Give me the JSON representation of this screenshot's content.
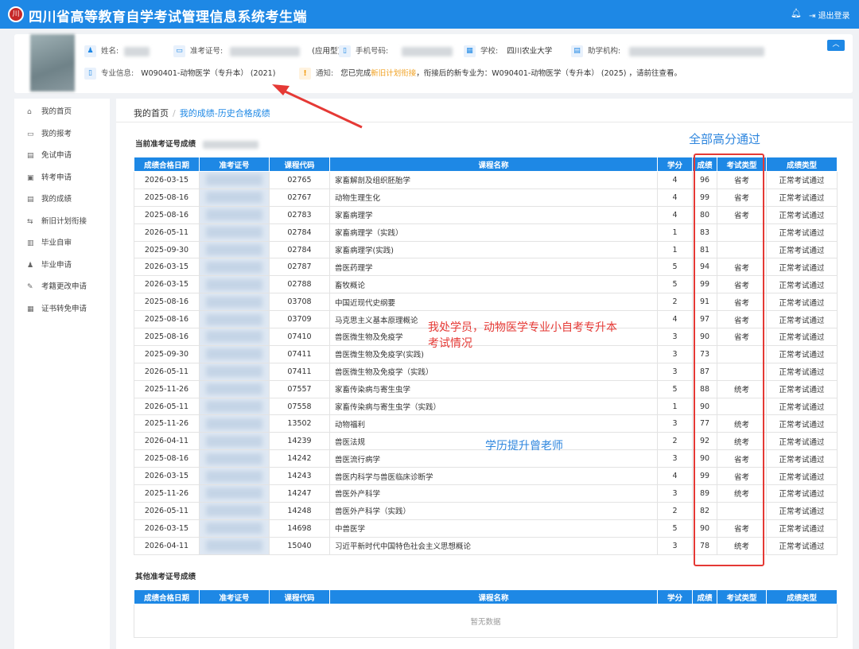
{
  "app": {
    "title": "四川省高等教育自学考试管理信息系统考生端",
    "logo_text": "川",
    "logout": "退出登录"
  },
  "profile": {
    "name_label": "姓名:",
    "ticket_label": "准考证号:",
    "ticket_type": "(应用型)",
    "phone_label": "手机号码:",
    "school_label": "学校:",
    "school_value": "四川农业大学",
    "agency_label": "助学机构:",
    "major_label": "专业信息:",
    "major_value": "W090401-动物医学（专升本） (2021)",
    "notice_label": "通知:",
    "notice_prefix": "您已完成",
    "notice_link": "新旧计划衔接",
    "notice_suffix": "，衔接后的新专业为：W090401-动物医学（专升本） (2025) ，请前往查看。"
  },
  "sidebar": {
    "items": [
      {
        "icon": "home-icon",
        "glyph": "⌂",
        "label": "我的首页"
      },
      {
        "icon": "calendar-icon",
        "glyph": "▭",
        "label": "我的报考"
      },
      {
        "icon": "file-icon",
        "glyph": "▤",
        "label": "免试申请"
      },
      {
        "icon": "lock-icon",
        "glyph": "▣",
        "label": "转考申请"
      },
      {
        "icon": "document-icon",
        "glyph": "▤",
        "label": "我的成绩"
      },
      {
        "icon": "swap-icon",
        "glyph": "⇆",
        "label": "新旧计划衔接"
      },
      {
        "icon": "file-icon",
        "glyph": "▥",
        "label": "毕业自审"
      },
      {
        "icon": "user-icon",
        "glyph": "♟",
        "label": "毕业申请"
      },
      {
        "icon": "edit-icon",
        "glyph": "✎",
        "label": "考籍更改申请"
      },
      {
        "icon": "certificate-icon",
        "glyph": "▦",
        "label": "证书转免申请"
      }
    ]
  },
  "breadcrumb": {
    "home": "我的首页",
    "sep": "/",
    "current": "我的成绩-历史合格成绩"
  },
  "current_section": {
    "title": "当前准考证号成绩"
  },
  "other_section": {
    "title": "其他准考证号成绩",
    "empty": "暂无数据"
  },
  "columns": [
    "成绩合格日期",
    "准考证号",
    "课程代码",
    "课程名称",
    "学分",
    "成绩",
    "考试类型",
    "成绩类型"
  ],
  "rows": [
    [
      "2026-03-15",
      "",
      "02765",
      "家畜解剖及组织胚胎学",
      "4",
      "96",
      "省考",
      "正常考试通过"
    ],
    [
      "2025-08-16",
      "",
      "02767",
      "动物生理生化",
      "4",
      "99",
      "省考",
      "正常考试通过"
    ],
    [
      "2025-08-16",
      "",
      "02783",
      "家畜病理学",
      "4",
      "80",
      "省考",
      "正常考试通过"
    ],
    [
      "2026-05-11",
      "",
      "02784",
      "家畜病理学（实践）",
      "1",
      "83",
      "",
      "正常考试通过"
    ],
    [
      "2025-09-30",
      "",
      "02784",
      "家畜病理学(实践)",
      "1",
      "81",
      "",
      "正常考试通过"
    ],
    [
      "2026-03-15",
      "",
      "02787",
      "兽医药理学",
      "5",
      "94",
      "省考",
      "正常考试通过"
    ],
    [
      "2026-03-15",
      "",
      "02788",
      "畜牧概论",
      "5",
      "99",
      "省考",
      "正常考试通过"
    ],
    [
      "2025-08-16",
      "",
      "03708",
      "中国近现代史纲要",
      "2",
      "91",
      "省考",
      "正常考试通过"
    ],
    [
      "2025-08-16",
      "",
      "03709",
      "马克思主义基本原理概论",
      "4",
      "97",
      "省考",
      "正常考试通过"
    ],
    [
      "2025-08-16",
      "",
      "07410",
      "兽医微生物及免疫学",
      "3",
      "90",
      "省考",
      "正常考试通过"
    ],
    [
      "2025-09-30",
      "",
      "07411",
      "兽医微生物及免疫学(实践)",
      "3",
      "73",
      "",
      "正常考试通过"
    ],
    [
      "2026-05-11",
      "",
      "07411",
      "兽医微生物及免疫学（实践）",
      "3",
      "87",
      "",
      "正常考试通过"
    ],
    [
      "2025-11-26",
      "",
      "07557",
      "家畜传染病与寄生虫学",
      "5",
      "88",
      "统考",
      "正常考试通过"
    ],
    [
      "2026-05-11",
      "",
      "07558",
      "家畜传染病与寄生虫学（实践）",
      "1",
      "90",
      "",
      "正常考试通过"
    ],
    [
      "2025-11-26",
      "",
      "13502",
      "动物福利",
      "3",
      "77",
      "统考",
      "正常考试通过"
    ],
    [
      "2026-04-11",
      "",
      "14239",
      "兽医法规",
      "2",
      "92",
      "统考",
      "正常考试通过"
    ],
    [
      "2025-08-16",
      "",
      "14242",
      "兽医流行病学",
      "3",
      "90",
      "省考",
      "正常考试通过"
    ],
    [
      "2026-03-15",
      "",
      "14243",
      "兽医内科学与兽医临床诊断学",
      "4",
      "99",
      "省考",
      "正常考试通过"
    ],
    [
      "2025-11-26",
      "",
      "14247",
      "兽医外产科学",
      "3",
      "89",
      "统考",
      "正常考试通过"
    ],
    [
      "2026-05-11",
      "",
      "14248",
      "兽医外产科学（实践）",
      "2",
      "82",
      "",
      "正常考试通过"
    ],
    [
      "2026-03-15",
      "",
      "14698",
      "中兽医学",
      "5",
      "90",
      "省考",
      "正常考试通过"
    ],
    [
      "2026-04-11",
      "",
      "15040",
      "习近平新时代中国特色社会主义思想概论",
      "3",
      "78",
      "统考",
      "正常考试通过"
    ]
  ],
  "annotations": {
    "top_right": "全部高分通过",
    "middle_line1": "我处学员，动物医学专业小自考专升本",
    "middle_line2": "考试情况",
    "teacher": "学历提升曾老师",
    "accent_red": "#e53935",
    "accent_blue": "#1e88e5"
  }
}
